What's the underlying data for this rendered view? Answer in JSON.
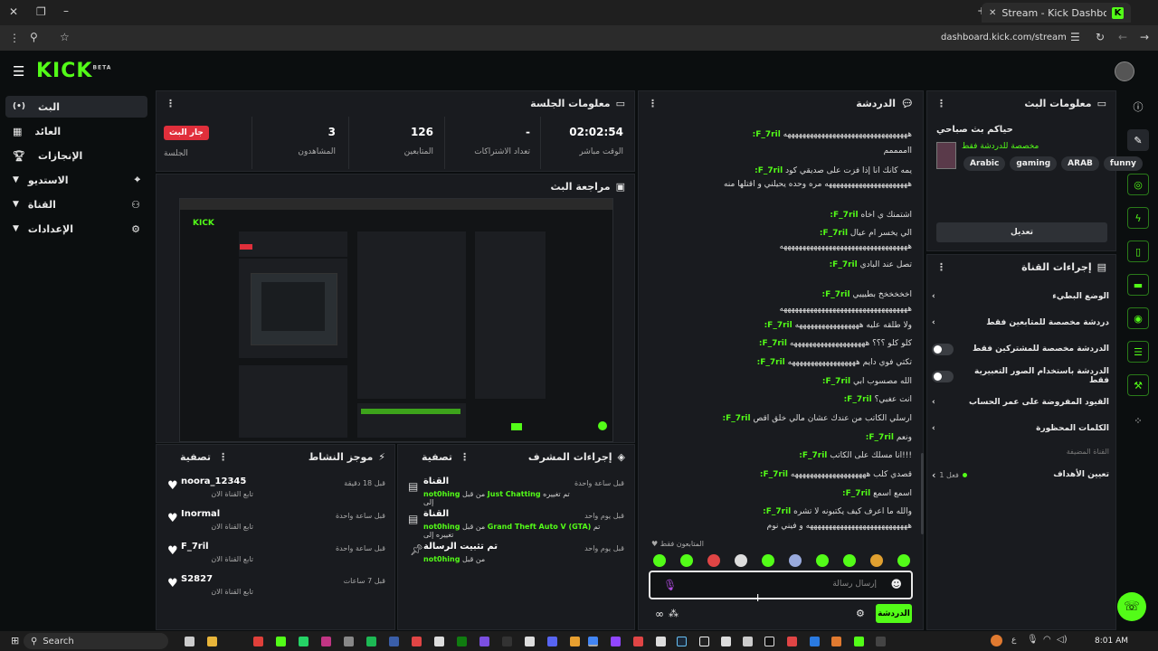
{
  "browser": {
    "tab_title": "Stream - Kick Dashboard",
    "url": "dashboard.kick.com/stream"
  },
  "app": {
    "logo": "KICK",
    "logo_badge": "BETA"
  },
  "sidebar": {
    "items": [
      {
        "label": "البث"
      },
      {
        "label": "العائد"
      },
      {
        "label": "الإنجازات"
      },
      {
        "label": "الاستديو"
      },
      {
        "label": "القناة"
      },
      {
        "label": "الإعدادات"
      }
    ]
  },
  "session": {
    "title": "معلومات الجلسة",
    "stats": [
      {
        "value": "02:02:54",
        "label": "الوقت مباشر"
      },
      {
        "value": "-",
        "label": "تعداد الاشتراكات"
      },
      {
        "value": "126",
        "label": "المتابعين"
      },
      {
        "value": "3",
        "label": "المشاهدون"
      }
    ],
    "live_badge": "جار البث",
    "live_label": "الجلسة"
  },
  "preview": {
    "title": "مراجعة البث"
  },
  "chat": {
    "title": "الدردشة",
    "messages": [
      {
        "user": "F_7ril:",
        "text": "هههههههههههههههههههههههههههههههههه"
      },
      {
        "user": "",
        "text": "ااممممم"
      },
      {
        "user": "F_7ril:",
        "text": "يمه كانك انا إذا فزت على صديقي كود"
      },
      {
        "user": "",
        "text": "ههههههههههههههههههههههه مره وحده يحيلني و اقتلها منه"
      },
      {
        "user": "F_7ril:",
        "text": "اشتمنك ي اخاه"
      },
      {
        "user": "F_7ril:",
        "text": "الي يخسر ام عيال"
      },
      {
        "user": "",
        "text": "ههههههههههههههههههههههههههههههههههه"
      },
      {
        "user": "F_7ril:",
        "text": "تصل عند البادي"
      },
      {
        "user": "F_7ril:",
        "text": "اخخخخخخ بطيييي"
      },
      {
        "user": "",
        "text": "ههههههههههههههههههههههههههههههههههه"
      },
      {
        "user": "F_7ril:",
        "text": "ولا طلقه عليه هههههههههههههههههه"
      },
      {
        "user": "F_7ril:",
        "text": "كلو كلو ؟؟؟ ههههههههههههههههههههه"
      },
      {
        "user": "F_7ril:",
        "text": "تكتي فوي دايم ههههههههههههههههههه"
      },
      {
        "user": "F_7ril:",
        "text": "الله مصسوب ابي"
      },
      {
        "user": "F_7ril:",
        "text": "انت عغبي؟"
      },
      {
        "user": "F_7ril:",
        "text": "ارسلي الكاتب من عندك عشان مالي خلق اقص"
      },
      {
        "user": "F_7ril:",
        "text": "ونعم"
      },
      {
        "user": "F_7ril:",
        "text": "!!!انا مسلك على الكاتب"
      },
      {
        "user": "F_7ril:",
        "text": "قصدي كلب ههههههههههههههههههههه"
      },
      {
        "user": "F_7ril:",
        "text": "اسمع اسمع"
      },
      {
        "user": "F_7ril:",
        "text": "والله ما اعرف كيف يكتبونه لا تشره"
      },
      {
        "user": "",
        "text": "هههههههههههههههههههههههههههه و فيني نوم"
      }
    ],
    "followers_only": "المتابعون فقط",
    "input_placeholder": "إرسال رسالة",
    "send_label": "الدردشة"
  },
  "stream_info": {
    "title": "معلومات البث",
    "stream_title": "حياكم بث صباحي",
    "category": "مخصصة للدردشة فقط",
    "tags": [
      "funny",
      "ARAB",
      "gaming",
      "Arabic"
    ],
    "edit_label": "تعديل"
  },
  "channel_actions": {
    "title": "إجراءات القناة",
    "rows": [
      {
        "label": "الوضع البطيء",
        "control": "chevron"
      },
      {
        "label": "دردشة مخصصة للمتابعين فقط",
        "control": "chevron"
      },
      {
        "label": "الدردشة مخصصة للمشتركين فقط",
        "control": "toggle"
      },
      {
        "label": "الدردشة باستخدام الصور التعبيرية فقط",
        "control": "toggle"
      },
      {
        "label": "القيود المفروضة على عمر الحساب",
        "control": "chevron"
      },
      {
        "label": "الكلمات المحظورة",
        "control": "chevron"
      }
    ],
    "pinned_channel": "القناة المضيفة",
    "goals_label": "تعيين الأهداف",
    "goals_status": "فعل 1"
  },
  "activity": {
    "title": "موجز النشاط",
    "filter_label": "تصفية",
    "items": [
      {
        "name": "noora_12345",
        "sub": "تابع القناة الان",
        "time": "قبل 18 دقيقة"
      },
      {
        "name": "Inormal",
        "sub": "تابع القناة الان",
        "time": "قبل ساعة واحدة"
      },
      {
        "name": "F_7ril",
        "sub": "تابع القناة الان",
        "time": "قبل ساعة واحدة"
      },
      {
        "name": "S2827",
        "sub": "تابع القناة الان",
        "time": "قبل 7 ساعات"
      }
    ]
  },
  "mod_actions": {
    "title": "إجراءات المشرف",
    "filter_label": "تصفية",
    "items": [
      {
        "title": "القناة",
        "pre": "تم تغييره إلى",
        "highlight": "Just Chatting",
        "mid": "من قبل",
        "user": "not0hing",
        "time": "قبل ساعة واحدة"
      },
      {
        "title": "القناة",
        "pre": "تم تغييره إلى",
        "highlight": "Grand Theft Auto V (GTA)",
        "mid": "من قبل",
        "user": "not0hing",
        "time": "قبل يوم واحد"
      },
      {
        "title": "تم تثبيت الرسالة",
        "pre": "من قبل",
        "highlight": "",
        "mid": "",
        "user": "not0hing",
        "time": "قبل يوم واحد"
      }
    ]
  },
  "taskbar": {
    "search": "Search",
    "time": "8:01 AM"
  },
  "colors": {
    "accent": "#53fc18",
    "live": "#e02f3b",
    "panel": "#191b1f",
    "background": "#0b0e0f"
  }
}
